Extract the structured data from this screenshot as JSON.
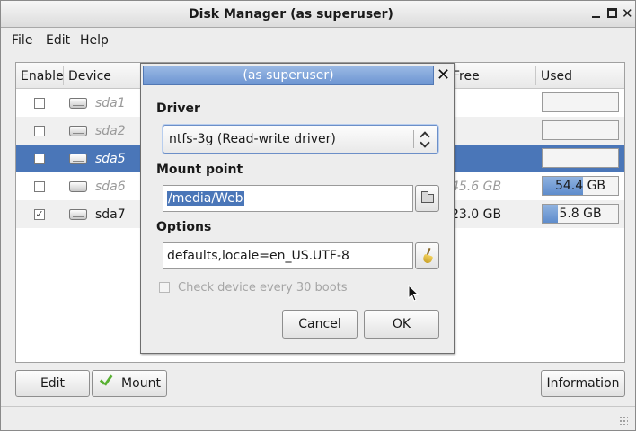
{
  "window": {
    "title": "Disk Manager (as superuser)"
  },
  "menu": {
    "file": "File",
    "edit": "Edit",
    "help": "Help"
  },
  "table": {
    "headers": {
      "enable": "Enable",
      "device": "Device",
      "free": "Free",
      "used": "Used"
    },
    "rows": [
      {
        "enabled": false,
        "device": "sda1",
        "free": "",
        "used": "",
        "used_fraction": 0,
        "mounted": false
      },
      {
        "enabled": false,
        "device": "sda2",
        "free": "",
        "used": "",
        "used_fraction": 0,
        "mounted": false
      },
      {
        "enabled": false,
        "device": "sda5",
        "free": "",
        "used": "",
        "used_fraction": 0,
        "mounted": false,
        "selected": true
      },
      {
        "enabled": false,
        "device": "sda6",
        "free": "45.6 GB",
        "used": "54.4 GB",
        "used_fraction": 0.54,
        "mounted": false
      },
      {
        "enabled": true,
        "device": "sda7",
        "free": "23.0 GB",
        "used": "5.8 GB",
        "used_fraction": 0.2,
        "mounted": true
      }
    ]
  },
  "buttons": {
    "edit": "Edit",
    "mount": "Mount",
    "information": "Information"
  },
  "dialog": {
    "title": "(as superuser)",
    "driver_label": "Driver",
    "driver_value": "ntfs-3g (Read-write driver)",
    "mount_point_label": "Mount point",
    "mount_point_value": "/media/Web",
    "options_label": "Options",
    "options_value": "defaults,locale=en_US.UTF-8",
    "check_label": "Check device every 30 boots",
    "cancel": "Cancel",
    "ok": "OK"
  },
  "icons": {
    "close": "close-icon",
    "folder": "folder-icon",
    "broom": "broom-icon",
    "check": "checkmark-icon",
    "drive": "drive-icon"
  },
  "colors": {
    "selection": "#4a76b8",
    "dialog_title": "#7a9fd8",
    "used_fill": "#6f98d2",
    "mount_check": "#58b032"
  }
}
